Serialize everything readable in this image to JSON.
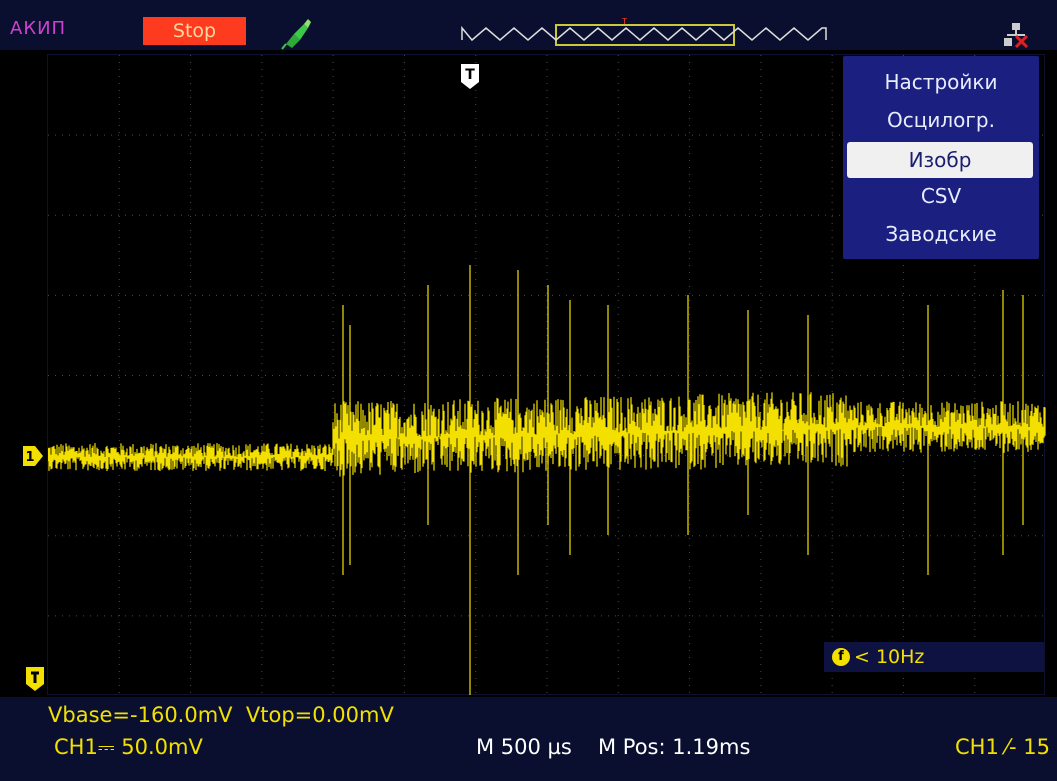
{
  "header": {
    "brand": "АКИП",
    "run_state": "Stop",
    "trigger_marker": "T"
  },
  "menu": {
    "items": [
      {
        "label": "Настройки",
        "selected": false
      },
      {
        "label": "Осцилогр.",
        "selected": false
      },
      {
        "label": "Изобр",
        "selected": true
      },
      {
        "label": "CSV",
        "selected": false
      },
      {
        "label": "Заводские",
        "selected": false
      }
    ]
  },
  "markers": {
    "channel": "1",
    "trigger_top": "T"
  },
  "frequency": {
    "icon": "f",
    "readout": "< 10Hz"
  },
  "measurements": {
    "text": "Vbase=-160.0mV  Vtop=0.00mV"
  },
  "status": {
    "channel_scale": "CH1⎓ 50.0mV",
    "timebase": "M 500 µs",
    "mpos": "M Pos: 1.19ms",
    "trigger": "CH1 ⁄- 15"
  },
  "colors": {
    "trace": "#f3e000",
    "menu_bg": "#1b2080",
    "stop": "#ff3b1f",
    "brand": "#d040d0",
    "grid": "#4a4a4a"
  }
}
